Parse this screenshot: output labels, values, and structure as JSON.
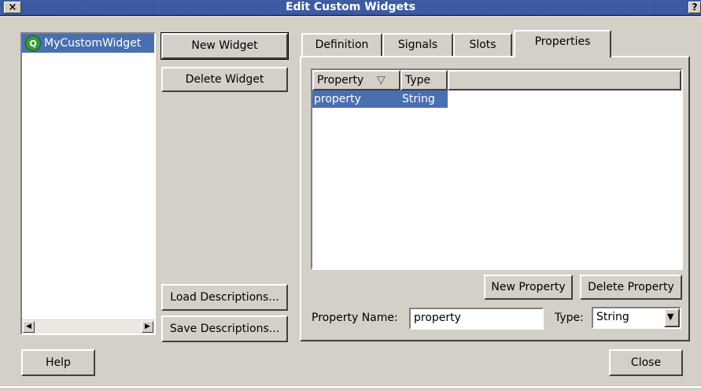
{
  "window": {
    "title": "Edit Custom Widgets",
    "close_glyph": "×",
    "help_glyph": "?"
  },
  "widget_list": {
    "items": [
      {
        "label": "MyCustomWidget",
        "icon": "qt-logo-icon"
      }
    ],
    "scroll_left": "◀",
    "scroll_right": "▶"
  },
  "buttons": {
    "new_widget": "New Widget",
    "delete_widget": "Delete Widget",
    "load_descriptions": "Load Descriptions...",
    "save_descriptions": "Save Descriptions...",
    "help": "Help",
    "close": "Close"
  },
  "tabs": [
    {
      "label": "Definition",
      "active": false
    },
    {
      "label": "Signals",
      "active": false
    },
    {
      "label": "Slots",
      "active": false
    },
    {
      "label": "Properties",
      "active": true
    }
  ],
  "properties_tab": {
    "columns": [
      {
        "label": "Property",
        "sort_glyph": "▽"
      },
      {
        "label": "Type"
      }
    ],
    "rows": [
      {
        "property": "property",
        "type": "String"
      }
    ],
    "new_property_label": "New Property",
    "delete_property_label": "Delete Property",
    "property_name_label": "Property Name:",
    "property_name_value": "property",
    "type_label": "Type:",
    "type_value": "String",
    "combo_arrow": "▼"
  },
  "colors": {
    "selection": "#4a6fb0",
    "titlebar": "#2d4d9a",
    "face": "#d4d0c8"
  }
}
